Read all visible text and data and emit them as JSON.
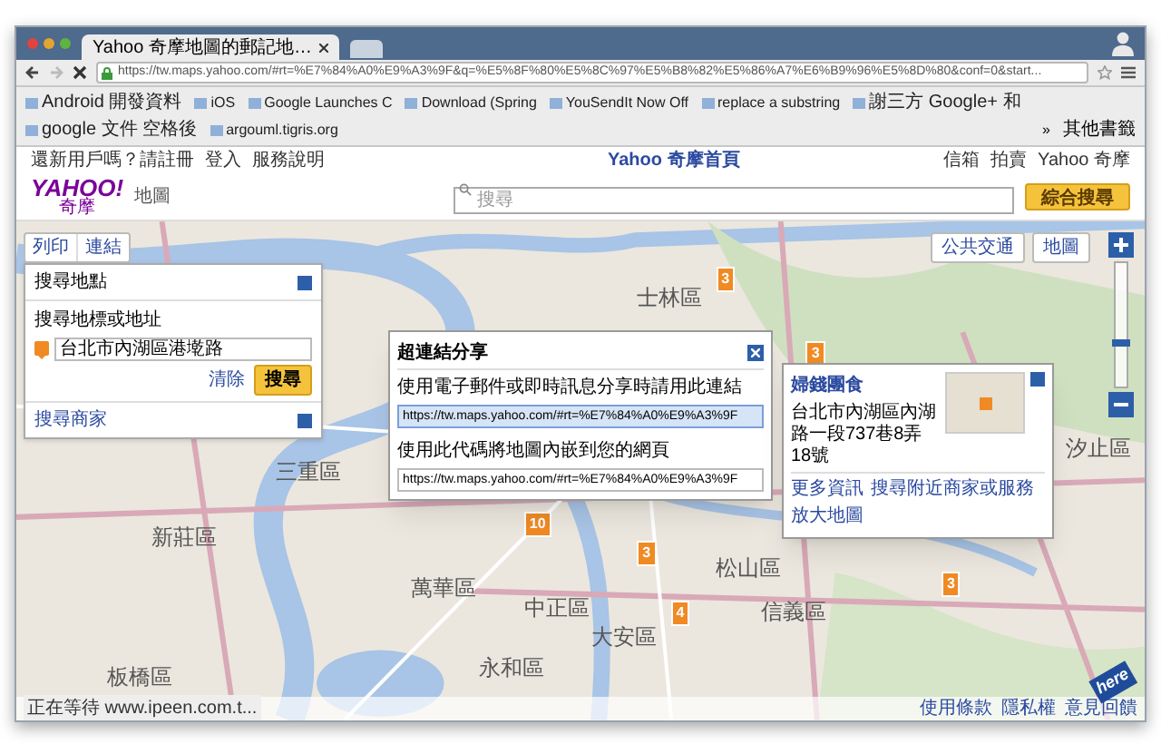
{
  "browser": {
    "tab": {
      "title": "Yahoo 奇摩地圖的郵記地…",
      "selected": true
    },
    "url": "https://tw.maps.yahoo.com/#rt=%E7%84%A0%E9%A3%9F&q=%E5%8F%80%E5%8C%97%E5%B8%82%E5%86%A7%E6%B9%96%E5%8D%80&conf=0&start...",
    "bookmarks": [
      "Android 開發資料",
      "iOS",
      "Google Launches C",
      "Download (Spring",
      "YouSendIt Now Off",
      "replace a substring",
      "謝三方 Google+ 和",
      "google 文件 空格後",
      "argouml.tigris.org"
    ],
    "overflow": "»",
    "other_bookmarks": "其他書籤"
  },
  "yahoo_header": {
    "left_links": [
      "還新用戶嗎？請註冊",
      "登入",
      "服務說明"
    ],
    "home_link": "Yahoo 奇摩首頁",
    "right_links": [
      "信箱",
      "拍賣",
      "Yahoo 奇摩"
    ]
  },
  "logo": {
    "brand": "YAHOO!",
    "brand_sub": "奇摩",
    "product": "地圖"
  },
  "search": {
    "placeholder": "搜尋",
    "button": "綜合搜尋"
  },
  "map": {
    "toolbar": [
      "列印",
      "連結"
    ],
    "layer_buttons": [
      "公共交通",
      "地圖"
    ],
    "districts": [
      "士林區",
      "三重區",
      "新莊區",
      "萬華區",
      "中正區",
      "大安區",
      "信義區",
      "松山區",
      "板橋區",
      "永和區",
      "汐止區"
    ],
    "markers": [
      "3",
      "3",
      "10",
      "3",
      "4",
      "3"
    ],
    "zoom": {
      "level": 0.35
    },
    "search_panel": {
      "title": "搜尋地點",
      "label": "搜尋地標或地址",
      "value": "台北市內湖區港墘路",
      "clear": "清除",
      "button": "搜尋",
      "business": "搜尋商家"
    },
    "share_dialog": {
      "title": "超連結分享",
      "link_label": "使用電子郵件或即時訊息分享時請用此連結",
      "link": "https://tw.maps.yahoo.com/#rt=%E7%84%A0%E9%A3%9F",
      "embed_label": "使用此代碼將地圖內嵌到您的網頁",
      "embed": "https://tw.maps.yahoo.com/#rt=%E7%84%A0%E9%A3%9F"
    },
    "info_panel": {
      "title": "婦錢團食",
      "address": "台北市內湖區內湖路一段737巷8弄 18號",
      "links": [
        "更多資訊",
        "搜尋附近商家或服務",
        "放大地圖"
      ]
    },
    "attribution": "here",
    "footer_links": [
      "使用條款",
      "隱私權",
      "意見回饋"
    ]
  },
  "status_bar": "正在等待 www.ipeen.com.t..."
}
